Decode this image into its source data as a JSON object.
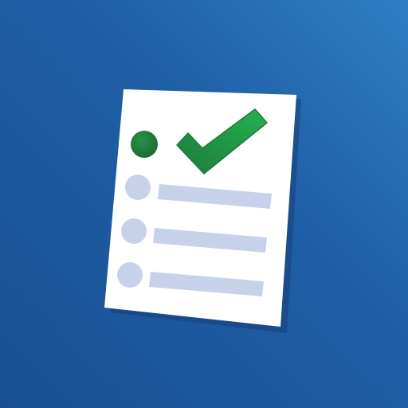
{
  "icon": {
    "name": "checklist-app-icon",
    "colors": {
      "background_light": "#2e7ec3",
      "background_dark": "#1a4f94",
      "paper": "#ffffff",
      "check_green": "#1fa64a",
      "check_green_dark": "#1e7a3c",
      "done_bullet": "#1f7a3a",
      "pending_bullet": "#c7d2ea",
      "line": "#c7d2ea",
      "shadow": "#163f78"
    },
    "items": [
      {
        "state": "done"
      },
      {
        "state": "pending"
      },
      {
        "state": "pending"
      },
      {
        "state": "pending"
      }
    ]
  }
}
